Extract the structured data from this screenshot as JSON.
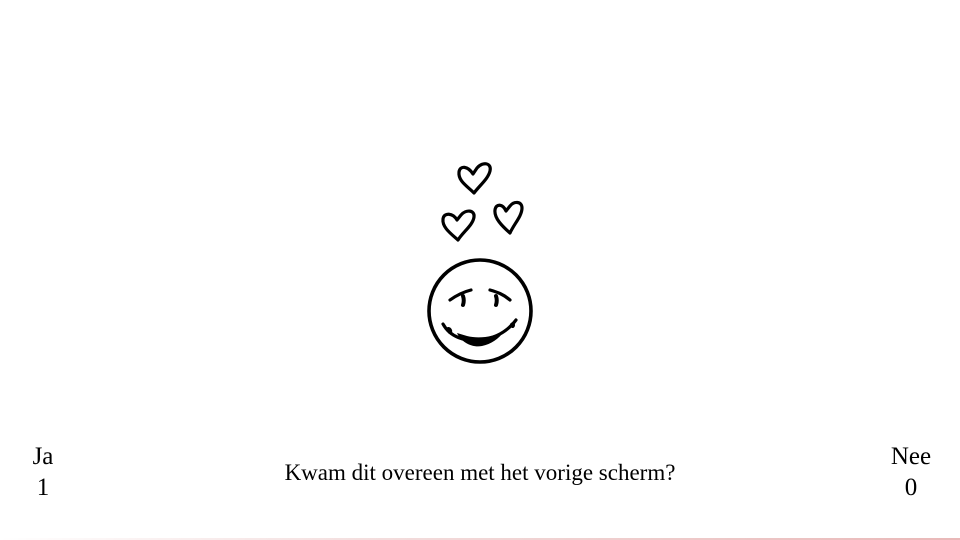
{
  "stimulus": {
    "icon": "smiley-with-hearts-icon"
  },
  "answers": {
    "yes": {
      "label": "Ja",
      "key": "1"
    },
    "no": {
      "label": "Nee",
      "key": "0"
    }
  },
  "question": {
    "text": "Kwam dit overeen met het vorige scherm?"
  },
  "colors": {
    "background": "#ffffff",
    "ink": "#000000"
  }
}
